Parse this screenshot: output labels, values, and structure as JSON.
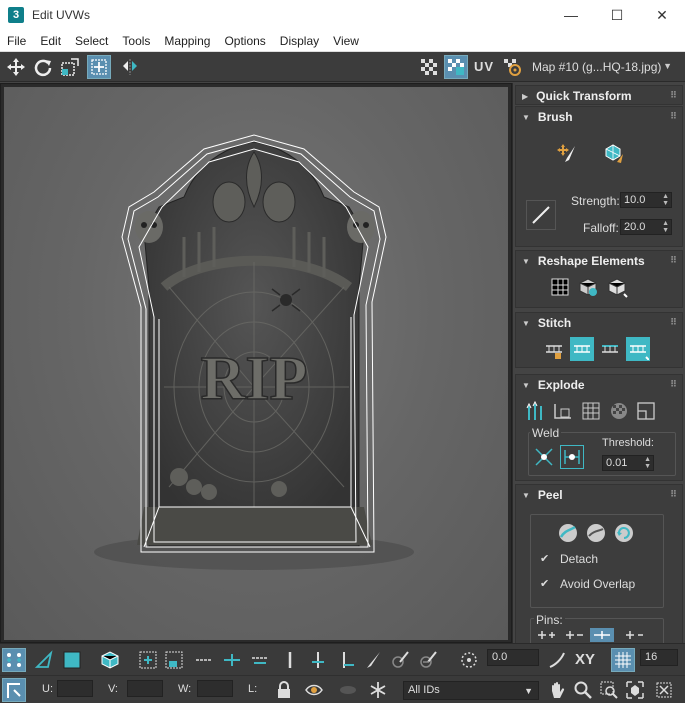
{
  "window": {
    "app_icon_label": "3",
    "title": "Edit UVWs",
    "minimize_glyph": "—",
    "maximize_glyph": "☐",
    "close_glyph": "✕"
  },
  "menu": [
    "File",
    "Edit",
    "Select",
    "Tools",
    "Mapping",
    "Options",
    "Display",
    "View"
  ],
  "toolbar": {
    "uv_label": "UV",
    "map_select": "Map #10 (g...HQ-18.jpg)"
  },
  "viewport": {
    "stone_text": "RIP"
  },
  "panel": {
    "quick_transform": {
      "title": "Quick Transform"
    },
    "brush": {
      "title": "Brush",
      "strength_label": "Strength:",
      "strength_value": "10.0",
      "falloff_label": "Falloff:",
      "falloff_value": "20.0"
    },
    "reshape": {
      "title": "Reshape Elements"
    },
    "stitch": {
      "title": "Stitch"
    },
    "explode": {
      "title": "Explode",
      "weld_label": "Weld",
      "threshold_label": "Threshold:",
      "threshold_value": "0.01"
    },
    "peel": {
      "title": "Peel",
      "detach_label": "Detach",
      "detach_checked": "✔",
      "avoid_overlap_label": "Avoid Overlap",
      "avoid_overlap_checked": "✔",
      "pins_label": "Pins:"
    }
  },
  "bottom": {
    "rotation_value": "0.0",
    "xy_label": "XY",
    "grid_value": "16",
    "u_label": "U:",
    "v_label": "V:",
    "w_label": "W:",
    "l_label": "L:",
    "u_value": "",
    "v_value": "",
    "w_value": "",
    "ids_select": "All IDs"
  },
  "colors": {
    "accent": "#3fb8c4",
    "active_blue": "#5a8fb0",
    "panel_bg": "#444444",
    "viewport_bg": "#666666"
  }
}
